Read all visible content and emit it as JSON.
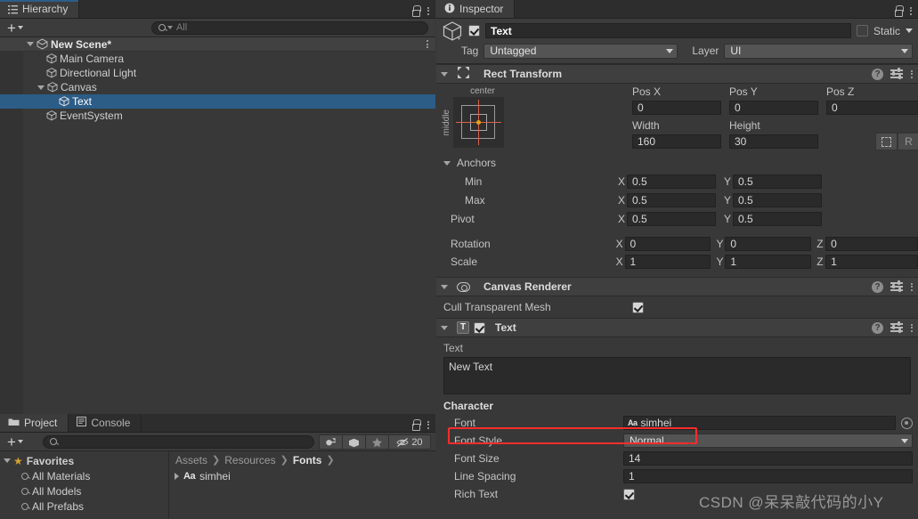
{
  "hierarchy": {
    "tab_label": "Hierarchy",
    "tab_icon": "hierarchy-icon",
    "add_label": "+",
    "search_placeholder": "All",
    "rows": [
      {
        "label": "New Scene*",
        "icon": "scene-icon",
        "depth": 0,
        "expanded": true,
        "selected": false
      },
      {
        "label": "Main Camera",
        "icon": "gameobject-cube-icon",
        "depth": 1,
        "expanded": null,
        "selected": false
      },
      {
        "label": "Directional Light",
        "icon": "gameobject-cube-icon",
        "depth": 1,
        "expanded": null,
        "selected": false
      },
      {
        "label": "Canvas",
        "icon": "gameobject-cube-icon",
        "depth": 1,
        "expanded": true,
        "selected": false
      },
      {
        "label": "Text",
        "icon": "gameobject-cube-icon",
        "depth": 2,
        "expanded": null,
        "selected": true
      },
      {
        "label": "EventSystem",
        "icon": "gameobject-cube-icon",
        "depth": 1,
        "expanded": null,
        "selected": false
      }
    ]
  },
  "project": {
    "tabs": [
      {
        "label": "Project",
        "icon": "folder-icon",
        "active": true
      },
      {
        "label": "Console",
        "icon": "console-icon",
        "active": false
      }
    ],
    "add_label": "+",
    "search_placeholder": "",
    "toolbar_icons": [
      "save-search-icon",
      "label-icon",
      "favorite-star-icon"
    ],
    "hidden_count": "20",
    "favorites": {
      "label": "Favorites",
      "items": [
        "All Materials",
        "All Models",
        "All Prefabs"
      ]
    },
    "breadcrumb": [
      "Assets",
      "Resources",
      "Fonts"
    ],
    "assets": [
      {
        "label": "simhei",
        "icon": "font-aa-icon"
      }
    ]
  },
  "inspector": {
    "tab_label": "Inspector",
    "tab_icon": "info-icon",
    "object": {
      "enabled": true,
      "name": "Text",
      "static_label": "Static",
      "static_checked": false,
      "tag_label": "Tag",
      "tag_value": "Untagged",
      "layer_label": "Layer",
      "layer_value": "UI"
    },
    "rect_transform": {
      "title": "Rect Transform",
      "anchor_preset_top": "center",
      "anchor_preset_side": "middle",
      "pos_labels": [
        "Pos X",
        "Pos Y",
        "Pos Z"
      ],
      "pos_values": [
        "0",
        "0",
        "0"
      ],
      "size_labels": [
        "Width",
        "Height"
      ],
      "size_values": [
        "160",
        "30"
      ],
      "anchors_label": "Anchors",
      "min_label": "Min",
      "min_x": "0.5",
      "min_y": "0.5",
      "max_label": "Max",
      "max_x": "0.5",
      "max_y": "0.5",
      "pivot_label": "Pivot",
      "pivot_x": "0.5",
      "pivot_y": "0.5",
      "rotation_label": "Rotation",
      "rotation": [
        "0",
        "0",
        "0"
      ],
      "scale_label": "Scale",
      "scale": [
        "1",
        "1",
        "1"
      ],
      "blueprint_button": "blueprint-mode-icon",
      "raw_button": "R"
    },
    "canvas_renderer": {
      "title": "Canvas Renderer",
      "cull_label": "Cull Transparent Mesh",
      "cull_checked": true
    },
    "text_component": {
      "title": "Text",
      "enabled": true,
      "text_label": "Text",
      "text_value": "New Text",
      "character_label": "Character",
      "font_label": "Font",
      "font_value": "simhei",
      "font_style_label": "Font Style",
      "font_style_value": "Normal",
      "font_size_label": "Font Size",
      "font_size_value": "14",
      "line_spacing_label": "Line Spacing",
      "line_spacing_value": "1",
      "rich_text_label": "Rich Text",
      "rich_text_checked": true
    }
  },
  "watermark": {
    "text": "CSDN @呆呆敲代码的小Y"
  },
  "colors": {
    "selection_blue": "#2c5d87",
    "highlight_red": "#ff2d2d",
    "anchor_orange": "#e8a117",
    "favorite_gold": "#d6a230"
  }
}
